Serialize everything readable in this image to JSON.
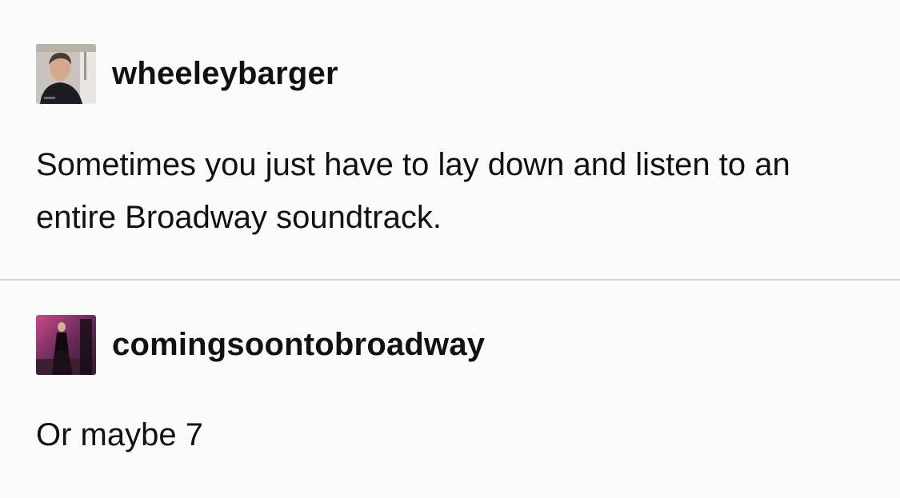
{
  "posts": [
    {
      "username": "wheeleybarger",
      "avatar_icon": "user-avatar-photo",
      "text": "Sometimes you just have to lay down and listen to an entire Broadway soundtrack."
    },
    {
      "username": "comingsoontobroadway",
      "avatar_icon": "user-avatar-stage-photo",
      "text": "Or maybe 7"
    }
  ],
  "colors": {
    "background": "#fbfbfb",
    "text": "#111111",
    "divider": "#d2d2d2"
  }
}
